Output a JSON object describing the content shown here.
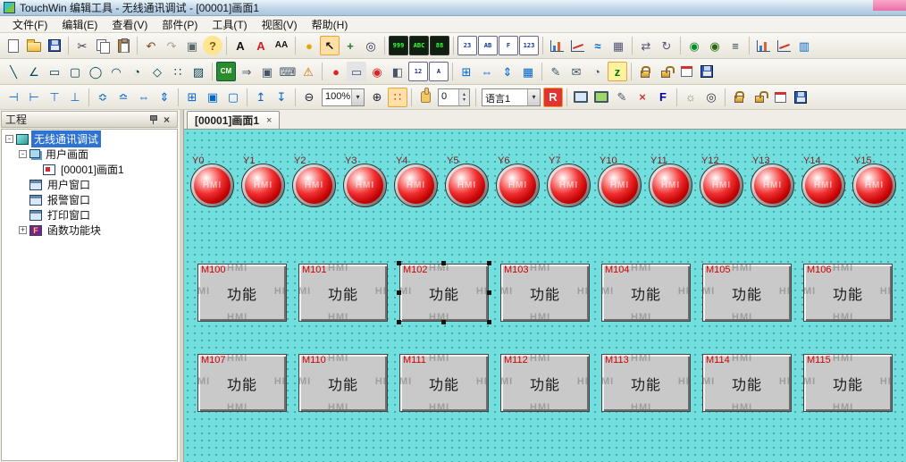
{
  "window": {
    "title": "TouchWin 编辑工具 - 无线通讯调试 - [00001]画面1"
  },
  "menu": {
    "items": [
      "文件(F)",
      "编辑(E)",
      "查看(V)",
      "部件(P)",
      "工具(T)",
      "视图(V)",
      "帮助(H)"
    ]
  },
  "toolbars": {
    "row1": [
      {
        "n": "new-file-icon",
        "sh": "page"
      },
      {
        "n": "open-folder-icon",
        "sh": "folder"
      },
      {
        "n": "save-icon",
        "sh": "floppy"
      },
      {
        "t": "sep"
      },
      {
        "n": "cut-icon",
        "g": "✂",
        "c": "#334"
      },
      {
        "n": "copy-icon",
        "sh": "copy"
      },
      {
        "n": "paste-icon",
        "sh": "paste"
      },
      {
        "t": "sep"
      },
      {
        "n": "undo-icon",
        "g": "↶",
        "c": "#7A4A1A"
      },
      {
        "n": "redo-icon",
        "g": "↷",
        "c": "#B0A090"
      },
      {
        "n": "macro-frame-icon",
        "g": "▣",
        "c": "#566"
      },
      {
        "n": "help-icon",
        "g": "?",
        "c": "#7A5C00",
        "bgc": "#FFE592",
        "round": 1,
        "b": 1
      },
      {
        "t": "sep"
      },
      {
        "n": "font-icon",
        "g": "A",
        "c": "#111",
        "b": 1
      },
      {
        "n": "text-color-icon",
        "g": "A",
        "c": "#C22",
        "b": 1
      },
      {
        "n": "font-size-icon",
        "g": "AA",
        "c": "#111",
        "b": 1,
        "fs": 10
      },
      {
        "t": "sep"
      },
      {
        "n": "static-lamp-icon",
        "g": "●",
        "c": "#E0A800"
      },
      {
        "n": "select-cursor-icon",
        "g": "↖",
        "c": "#111",
        "sel": 1,
        "b": 1
      },
      {
        "n": "pan-tool-icon",
        "g": "+",
        "c": "#2A7A2A",
        "b": 1
      },
      {
        "n": "zoom-tool-icon",
        "g": "◎",
        "c": "#335"
      },
      {
        "t": "sep"
      },
      {
        "n": "segment-display-icon",
        "t": "disp",
        "v": "999"
      },
      {
        "n": "ascii-display-icon",
        "t": "disp",
        "v": "ABC"
      },
      {
        "n": "led-display-icon",
        "t": "disp",
        "v": "88"
      },
      {
        "t": "sep"
      },
      {
        "n": "clock-part-icon",
        "t": "disp2",
        "v": "23"
      },
      {
        "n": "static-text-icon",
        "t": "disp2",
        "v": "AB"
      },
      {
        "n": "function-key-icon",
        "t": "disp2",
        "v": "F"
      },
      {
        "n": "data-input-icon",
        "t": "disp2",
        "v": "123"
      },
      {
        "t": "sep"
      },
      {
        "n": "bar-graph-icon",
        "sh": "bars"
      },
      {
        "n": "trend-graph-icon",
        "sh": "trend"
      },
      {
        "n": "xy-graph-icon",
        "g": "≈",
        "c": "#06C",
        "b": 1
      },
      {
        "n": "data-table-icon",
        "g": "▦",
        "c": "#557"
      },
      {
        "t": "sep"
      },
      {
        "n": "move-animation-icon",
        "g": "⇄",
        "c": "#557"
      },
      {
        "n": "rotate-animation-icon",
        "g": "↻",
        "c": "#557"
      },
      {
        "t": "sep"
      },
      {
        "n": "ethernet-device-icon",
        "g": "◉",
        "c": "#0A8A2A"
      },
      {
        "n": "network-setting-icon",
        "g": "◉",
        "c": "#2A6A0A"
      },
      {
        "n": "com-device-icon",
        "g": "≡",
        "c": "#345"
      },
      {
        "t": "sep"
      },
      {
        "n": "column-chart-icon",
        "sh": "bars"
      },
      {
        "n": "curve-chart-icon",
        "sh": "trend"
      },
      {
        "n": "report-icon",
        "g": "▥",
        "c": "#06C"
      }
    ],
    "row2": [
      {
        "n": "line-tool-icon",
        "g": "╲",
        "c": "#045"
      },
      {
        "n": "polyline-tool-icon",
        "g": "∠",
        "c": "#045"
      },
      {
        "n": "rect-tool-icon",
        "g": "▭",
        "c": "#045"
      },
      {
        "n": "roundrect-tool-icon",
        "g": "▢",
        "c": "#045"
      },
      {
        "n": "ellipse-tool-icon",
        "g": "◯",
        "c": "#045"
      },
      {
        "n": "arc-tool-icon",
        "g": "◠",
        "c": "#045"
      },
      {
        "n": "sector-tool-icon",
        "g": "◔",
        "c": "#045"
      },
      {
        "n": "polygon-tool-icon",
        "g": "◇",
        "c": "#045"
      },
      {
        "n": "dot-tool-icon",
        "g": "∷",
        "c": "#045"
      },
      {
        "n": "fill-tool-icon",
        "g": "▨",
        "c": "#045"
      },
      {
        "t": "sep"
      },
      {
        "n": "cm-block-icon",
        "t": "disp3",
        "v": "CM"
      },
      {
        "n": "screen-jump-icon",
        "g": "⇒",
        "c": "#456"
      },
      {
        "n": "window-part-icon",
        "g": "▣",
        "c": "#456"
      },
      {
        "n": "keyboard-part-icon",
        "g": "⌨",
        "c": "#456"
      },
      {
        "n": "alarm-part-icon",
        "g": "⚠",
        "c": "#C60"
      },
      {
        "t": "sep"
      },
      {
        "n": "indicator-lamp-icon",
        "g": "●",
        "c": "#D22"
      },
      {
        "n": "push-button-icon",
        "g": "▭",
        "c": "#456",
        "bgc": "#E4E4E4"
      },
      {
        "n": "lamp-button-icon",
        "g": "◉",
        "c": "#D22"
      },
      {
        "n": "multi-state-icon",
        "g": "◧",
        "c": "#456"
      },
      {
        "n": "numeric-display-icon",
        "t": "disp2",
        "v": "12"
      },
      {
        "n": "ascii-input-icon",
        "t": "disp2",
        "v": "A"
      },
      {
        "t": "sep"
      },
      {
        "n": "sub-window-icon",
        "g": "⊞",
        "c": "#06C"
      },
      {
        "n": "h-slider-icon",
        "g": "⇔",
        "c": "#06C"
      },
      {
        "n": "v-slider-icon",
        "g": "⇕",
        "c": "#06C"
      },
      {
        "n": "data-grid-icon",
        "g": "▦",
        "c": "#06C"
      },
      {
        "t": "sep"
      },
      {
        "n": "note-book-icon",
        "g": "✎",
        "c": "#456"
      },
      {
        "n": "message-display-icon",
        "g": "✉",
        "c": "#456"
      },
      {
        "n": "time-display-icon",
        "g": "◔",
        "c": "#456"
      },
      {
        "n": "z-layer-icon",
        "g": "z",
        "c": "#070",
        "bgc": "#FFF3A0",
        "sel": 1,
        "b": 1
      },
      {
        "t": "sep"
      },
      {
        "n": "encrypt-icon",
        "sh": "lock"
      },
      {
        "n": "decrypt-icon",
        "sh": "lockopen"
      },
      {
        "n": "schedule-icon",
        "sh": "calendar"
      },
      {
        "n": "store-icon",
        "sh": "floppy"
      }
    ],
    "row3": [
      {
        "n": "align-left-icon",
        "g": "⊣",
        "c": "#06C"
      },
      {
        "n": "align-right-icon",
        "g": "⊢",
        "c": "#06C"
      },
      {
        "n": "align-top-icon",
        "g": "⊤",
        "c": "#06C"
      },
      {
        "n": "align-bottom-icon",
        "g": "⊥",
        "c": "#06C"
      },
      {
        "t": "sep"
      },
      {
        "n": "center-horizontal-icon",
        "g": "≎",
        "c": "#06C"
      },
      {
        "n": "center-vertical-icon",
        "g": "≏",
        "c": "#06C"
      },
      {
        "n": "same-width-icon",
        "g": "⇔",
        "c": "#06C"
      },
      {
        "n": "same-height-icon",
        "g": "⇕",
        "c": "#06C"
      },
      {
        "t": "sep"
      },
      {
        "n": "same-size-icon",
        "g": "⊞",
        "c": "#06C"
      },
      {
        "n": "group-icon",
        "g": "▣",
        "c": "#06C"
      },
      {
        "n": "ungroup-icon",
        "g": "▢",
        "c": "#06C"
      },
      {
        "t": "sep"
      },
      {
        "n": "bring-front-icon",
        "g": "↥",
        "c": "#06C"
      },
      {
        "n": "send-back-icon",
        "g": "↧",
        "c": "#06C"
      },
      {
        "t": "sep"
      },
      {
        "n": "zoom-out-icon",
        "g": "⊖",
        "c": "#223"
      },
      {
        "n": "zoom-level-combo",
        "t": "combo",
        "v": "100%",
        "w": 48
      },
      {
        "n": "zoom-in-icon",
        "g": "⊕",
        "c": "#223"
      },
      {
        "n": "grid-toggle-icon",
        "g": "∷",
        "c": "#C33",
        "sel": 1
      },
      {
        "t": "sep"
      },
      {
        "n": "touch-hand-icon",
        "sh": "hand"
      },
      {
        "n": "state-spinner",
        "t": "spin",
        "v": "0"
      },
      {
        "t": "sep"
      },
      {
        "n": "language-combo",
        "t": "combo",
        "v": "语言1",
        "w": 66
      },
      {
        "n": "language-r-button",
        "g": "R",
        "c": "#FFF",
        "bgc": "#E23333",
        "sel": 1,
        "b": 1
      },
      {
        "t": "sep"
      },
      {
        "n": "offline-simulation-icon",
        "sh": "monitor"
      },
      {
        "n": "online-simulation-icon",
        "sh": "monitor2"
      },
      {
        "n": "modify-icon",
        "g": "✎",
        "c": "#456"
      },
      {
        "n": "clear-icon",
        "g": "×",
        "c": "#C33",
        "b": 1
      },
      {
        "n": "function-f-icon",
        "g": "F",
        "c": "#00A",
        "b": 1
      },
      {
        "t": "sep"
      },
      {
        "n": "build-icon",
        "g": "☼",
        "c": "#886"
      },
      {
        "n": "search-icon",
        "g": "◎",
        "c": "#334"
      },
      {
        "t": "sep"
      },
      {
        "n": "download-protect-icon",
        "sh": "lock"
      },
      {
        "n": "upload-protect-icon",
        "sh": "lockopen"
      },
      {
        "n": "clock-config-icon",
        "sh": "calendar"
      },
      {
        "n": "flash-icon",
        "sh": "floppy"
      }
    ]
  },
  "project_panel": {
    "title": "工程",
    "tree": [
      {
        "label": "无线通讯调试",
        "level": 0,
        "exp": "-",
        "icon": "ti-root",
        "iconName": "project-root-icon",
        "sel": true
      },
      {
        "label": "用户画面",
        "level": 1,
        "exp": "-",
        "icon": "ti-screens",
        "iconName": "user-screens-icon"
      },
      {
        "label": "[00001]画面1",
        "level": 2,
        "exp": "",
        "icon": "ti-screen1",
        "iconName": "screen1-icon"
      },
      {
        "label": "用户窗口",
        "level": 1,
        "exp": "",
        "icon": "ti-window",
        "iconName": "user-window-icon"
      },
      {
        "label": "报警窗口",
        "level": 1,
        "exp": "",
        "icon": "ti-window",
        "iconName": "alarm-window-icon"
      },
      {
        "label": "打印窗口",
        "level": 1,
        "exp": "",
        "icon": "ti-window",
        "iconName": "print-window-icon"
      },
      {
        "label": "函数功能块",
        "level": 1,
        "exp": "+",
        "icon": "ti-func",
        "iconName": "function-block-icon"
      }
    ]
  },
  "tabs": [
    {
      "label": "[00001]画面1"
    }
  ],
  "canvas": {
    "bg_color": "#72DEDE",
    "grid_dot_color": "#2E9898",
    "lamps": {
      "watermark": "HMI",
      "color": "#E01010",
      "address_color": "#8B1A1A",
      "labels": [
        "Y0",
        "Y1",
        "Y2",
        "Y3",
        "Y4",
        "Y5",
        "Y6",
        "Y7",
        "Y10",
        "Y11",
        "Y12",
        "Y13",
        "Y14",
        "Y15"
      ]
    },
    "buttons": {
      "text": "功能",
      "watermark": "HMI",
      "color": "#C9C9C9",
      "address_color": "#D00000",
      "selected": "M102",
      "row1": [
        "M100",
        "M101",
        "M102",
        "M103",
        "M104",
        "M105",
        "M106"
      ],
      "row2": [
        "M107",
        "M110",
        "M111",
        "M112",
        "M113",
        "M114",
        "M115"
      ]
    }
  }
}
